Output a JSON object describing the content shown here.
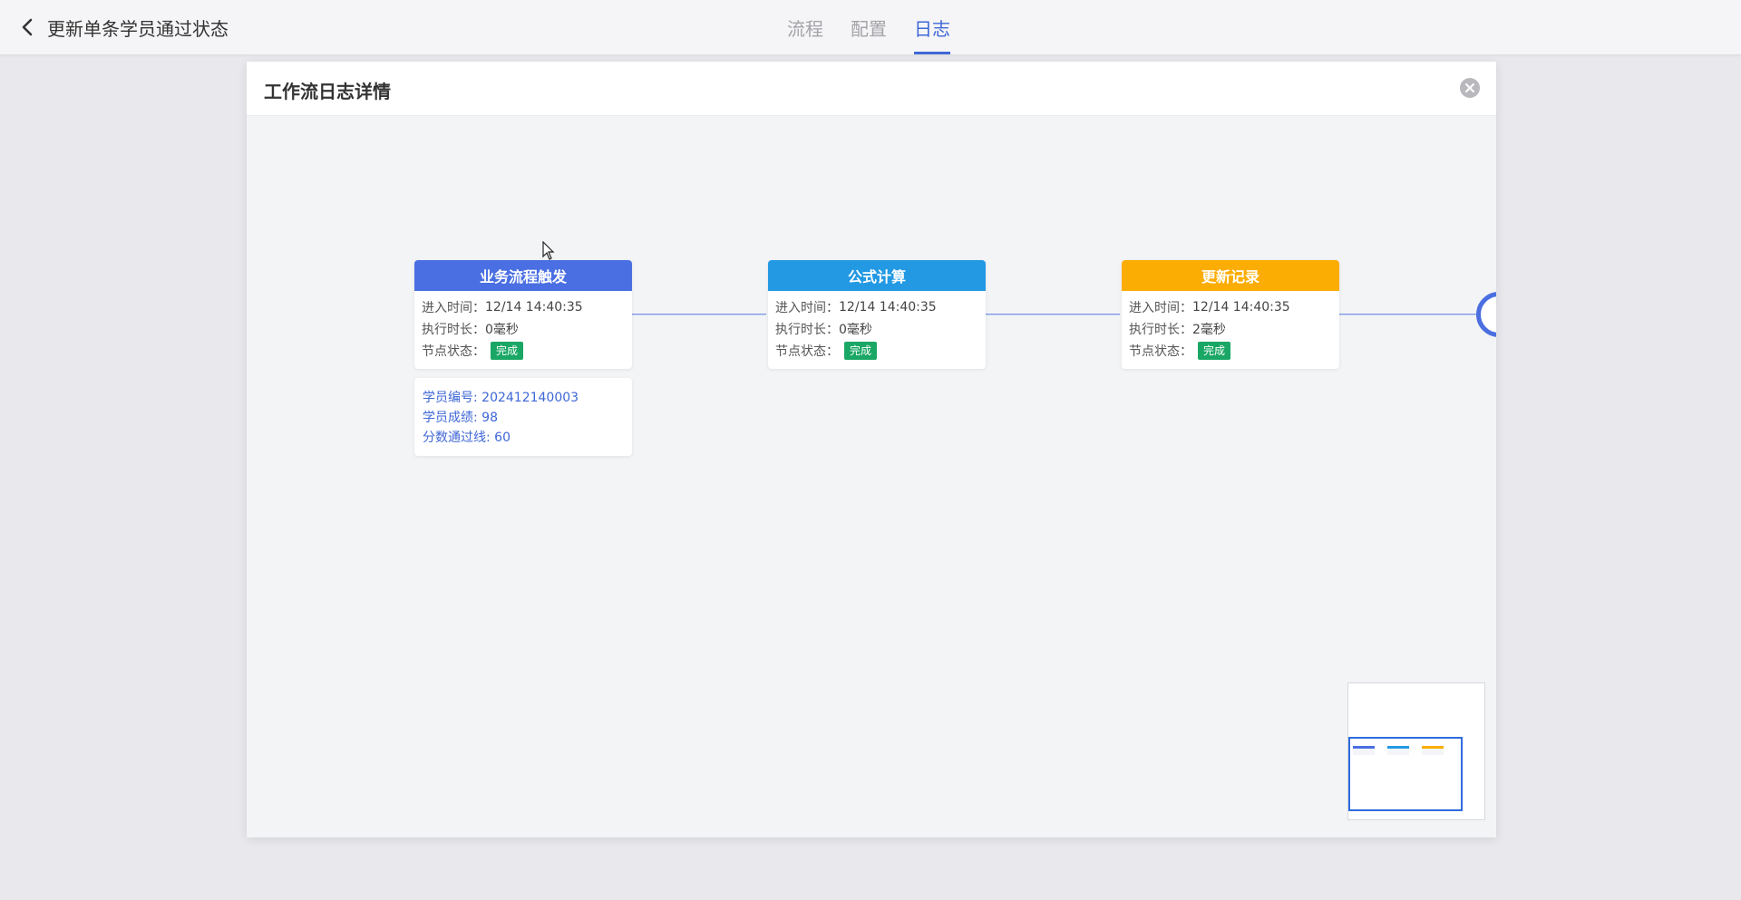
{
  "header": {
    "back_title": "更新单条学员通过状态",
    "tabs": [
      {
        "label": "流程",
        "active": false
      },
      {
        "label": "配置",
        "active": false
      },
      {
        "label": "日志",
        "active": true
      }
    ]
  },
  "dialog": {
    "title": "工作流日志详情",
    "close_icon": "close-circle-icon"
  },
  "labels": {
    "enter_time": "进入时间：",
    "duration": "执行时长：",
    "status": "节点状态："
  },
  "nodes": [
    {
      "title": "业务流程触发",
      "enter_time": "12/14 14:40:35",
      "duration": "0毫秒",
      "status": "完成",
      "color": "#4a6fe2"
    },
    {
      "title": "公式计算",
      "enter_time": "12/14 14:40:35",
      "duration": "0毫秒",
      "status": "完成",
      "color": "#2399e4"
    },
    {
      "title": "更新记录",
      "enter_time": "12/14 14:40:35",
      "duration": "2毫秒",
      "status": "完成",
      "color": "#fcad03"
    }
  ],
  "info_card": {
    "lines": [
      "学员编号: 202412140003",
      "学员成绩: 98",
      "分数通过线: 60"
    ]
  },
  "colors": {
    "accent": "#3f67d6",
    "status_done": "#1aa765"
  }
}
